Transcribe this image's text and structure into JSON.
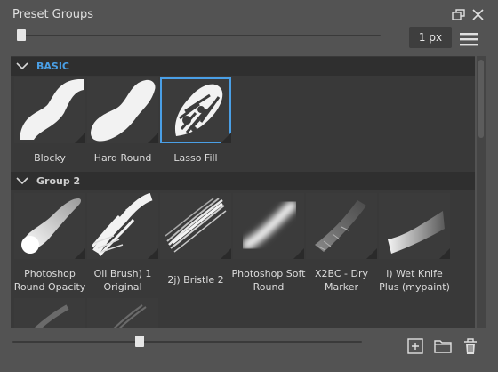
{
  "panel": {
    "title": "Preset Groups"
  },
  "size_slider": {
    "value_label": "1 px",
    "level": 0.0
  },
  "zoom_slider": {
    "level": 0.36
  },
  "groups": [
    {
      "name": "BASIC",
      "color": "#4a9fe6",
      "presets": [
        {
          "label": "Blocky"
        },
        {
          "label": "Hard Round"
        },
        {
          "label": "Lasso Fill",
          "selected": true
        }
      ]
    },
    {
      "name": "Group 2",
      "color": "#cfcfcf",
      "presets": [
        {
          "label": "Photoshop Round Opacity"
        },
        {
          "label": "Oil Brush) 1 Original"
        },
        {
          "label": "2j) Bristle 2"
        },
        {
          "label": "Photoshop Soft Round"
        },
        {
          "label": "X2BC - Dry Marker"
        },
        {
          "label": "i) Wet Knife Plus (mypaint)"
        }
      ]
    }
  ],
  "icons": {
    "float": "float-window-icon",
    "close": "close-icon",
    "menu": "hamburger-menu-icon",
    "add": "add-preset-icon",
    "folder": "folder-icon",
    "delete": "trash-icon"
  },
  "colors": {
    "accent": "#4a9fe6",
    "panel_bg": "#535353",
    "list_bg": "#393939"
  }
}
